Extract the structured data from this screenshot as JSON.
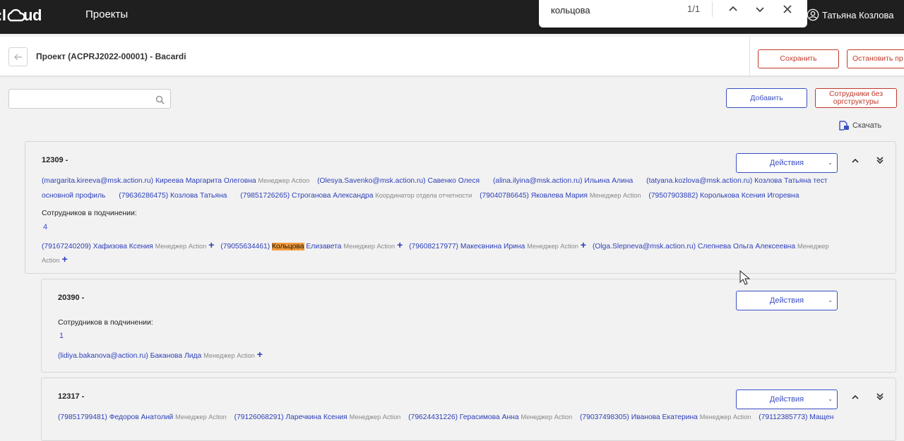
{
  "app": {
    "logo": "cloud",
    "nav_title": "Проекты",
    "user_name": "Татьяна Козлова"
  },
  "find": {
    "query": "кольцова",
    "count": "1/1"
  },
  "project": {
    "title": "Проект (ACPRJ2022-00001) - Bacardi",
    "save_label": "Сохранить",
    "stop_label": "Остановить пр"
  },
  "toolbar": {
    "search_placeholder": "",
    "add_label": "Добавить",
    "no_org_label_1": "Сотрудники без",
    "no_org_label_2": "оргструктуры",
    "download_label": "Скачать"
  },
  "colors": {
    "accent": "#3b4fc4",
    "danger": "#c0392b",
    "highlight": "#f39c3d"
  },
  "cards": [
    {
      "title": "12309 -",
      "actions_label": "Действия",
      "members_line1": [
        {
          "contact": "(margarita.kireeva@msk.action.ru) Киреева Маргарита Олеговна",
          "role": "Менеджер Action"
        },
        {
          "contact": "(Olesya.Savenko@msk.action.ru) Савенко Олеся",
          "role": ""
        },
        {
          "contact": "(alina.ilyina@msk.action.ru) Ильина Алина",
          "role": ""
        },
        {
          "contact": "(tatyana.kozlova@msk.action.ru) Козлова Татьяна тест",
          "role": ""
        }
      ],
      "members_line2": [
        {
          "contact": "основной профиль",
          "role": ""
        },
        {
          "contact": "(79636286475) Козлова Татьяна",
          "role": ""
        },
        {
          "contact": "(79851726265) Строганова Александра",
          "role": "Координатор отдела отчетности"
        },
        {
          "contact": "(79040786645) Яковлева Мария",
          "role": "Менеджер Action"
        },
        {
          "contact": "(79507903882) Королькова Ксения Игоревна",
          "role": ""
        }
      ],
      "sub_label": "Сотрудников в подчинении:",
      "sub_count": "4",
      "sub_line1": [
        {
          "contact": "(79167240209) Хафизова Ксения",
          "role": "Менеджер Action"
        },
        {
          "contact_pre": "(79055634461) ",
          "contact_hl": "Кольцова",
          "contact_post": " Елизавета",
          "role": "Менеджер Action"
        },
        {
          "contact": "(79608217977) Макеєвнина Ирина",
          "role": "Менеджер Action"
        },
        {
          "contact": "(Olga.Slepneva@msk.action.ru) Слепнева Ольга Алексеевна",
          "role": "Менеджер"
        }
      ],
      "sub_line2_role": "Action"
    },
    {
      "title": "20390 -",
      "actions_label": "Действия",
      "sub_label": "Сотрудников в подчинении:",
      "sub_count": "1",
      "sub_line1": [
        {
          "contact": "(lidiya.bakanova@action.ru) Баканова Лида",
          "role": "Менеджер Action"
        }
      ]
    },
    {
      "title": "12317 -",
      "actions_label": "Действия",
      "members_line1": [
        {
          "contact": "(79851799481) Федоров Анатолий",
          "role": "Менеджер Action"
        },
        {
          "contact": "(79126068291) Ларечкина Ксения",
          "role": "Менеджер Action"
        },
        {
          "contact": "(79624431226) Герасимова Анна",
          "role": "Менеджер Action"
        },
        {
          "contact": "(79037498305) Иванова Екатерина",
          "role": "Менеджер Action"
        },
        {
          "contact": "(79112385773) Мащен",
          "role": ""
        }
      ]
    }
  ]
}
